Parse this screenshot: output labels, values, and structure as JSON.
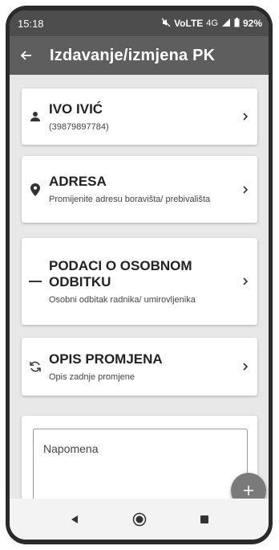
{
  "status_bar": {
    "time": "15:18",
    "mute_icon": "mute-icon",
    "volte_label": "VoLTE",
    "network": "4G",
    "battery": "92%"
  },
  "app_bar": {
    "title": "Izdavanje/izmjena PK",
    "back_icon": "arrow-left-icon"
  },
  "cards": [
    {
      "icon": "person-icon",
      "title": "IVO IVIĆ",
      "subtitle": "(39879897784)"
    },
    {
      "icon": "location-pin-icon",
      "title": "ADRESA",
      "subtitle": "Promijenite adresu boravišta/ prebivališta"
    },
    {
      "icon": "minus-icon",
      "title": "PODACI O OSOBNOM ODBITKU",
      "subtitle": "Osobni odbitak radnika/ umirovljenika"
    },
    {
      "icon": "sync-icon",
      "title": "OPIS PROMJENA",
      "subtitle": "Opis zadnje promjene"
    }
  ],
  "notes": {
    "placeholder": "Napomena"
  },
  "fab": {
    "label": "+"
  },
  "nav": {
    "back_icon": "triangle-back-icon",
    "home_icon": "home-circle-icon",
    "recents_icon": "square-recents-icon"
  },
  "colors": {
    "app_bar": "#5e5e5e",
    "status_bar": "#4d4d4d",
    "background": "#e8e8e8",
    "fab": "#7a7a7a"
  }
}
